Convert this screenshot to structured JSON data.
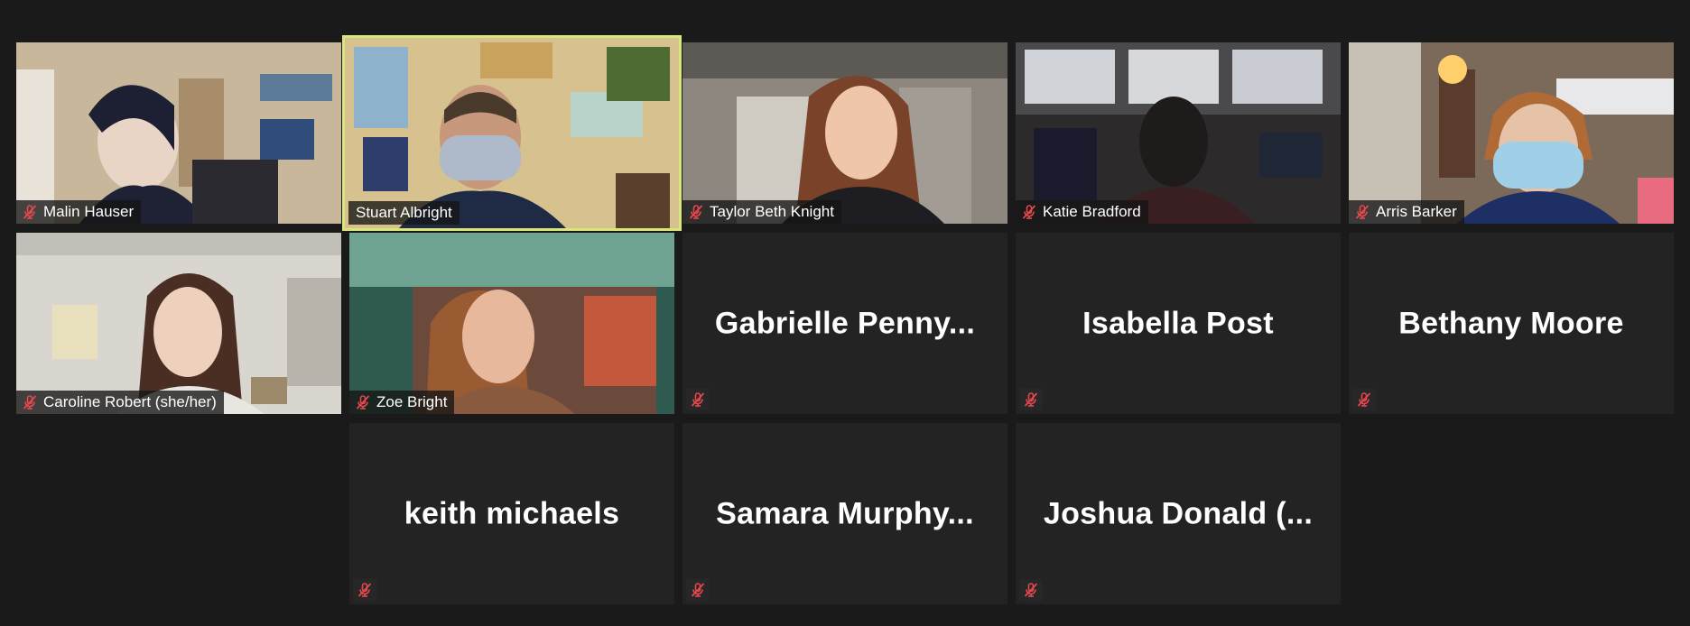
{
  "meeting": {
    "background_color": "#1a1a1a",
    "tile_color": "#232323",
    "active_speaker_border": "#d9e77a",
    "mute_icon_color": "#e5484d"
  },
  "participants": [
    {
      "name": "Malin Hauser",
      "video": true,
      "muted": true,
      "active": false
    },
    {
      "name": "Stuart Albright",
      "video": true,
      "muted": false,
      "active": true
    },
    {
      "name": "Taylor Beth Knight",
      "video": true,
      "muted": true,
      "active": false
    },
    {
      "name": "Katie Bradford",
      "video": true,
      "muted": true,
      "active": false
    },
    {
      "name": "Arris Barker",
      "video": true,
      "muted": true,
      "active": false
    },
    {
      "name": "Caroline Robert (she/her)",
      "video": true,
      "muted": true,
      "active": false
    },
    {
      "name": "Zoe Bright",
      "video": true,
      "muted": true,
      "active": false
    },
    {
      "name": "Gabrielle  Penny...",
      "video": false,
      "muted": true,
      "active": false
    },
    {
      "name": "Isabella Post",
      "video": false,
      "muted": true,
      "active": false
    },
    {
      "name": "Bethany Moore",
      "video": false,
      "muted": true,
      "active": false
    },
    {
      "name": "keith michaels",
      "video": false,
      "muted": true,
      "active": false
    },
    {
      "name": "Samara  Murphy...",
      "video": false,
      "muted": true,
      "active": false
    },
    {
      "name": "Joshua  Donald  (...",
      "video": false,
      "muted": true,
      "active": false
    }
  ]
}
